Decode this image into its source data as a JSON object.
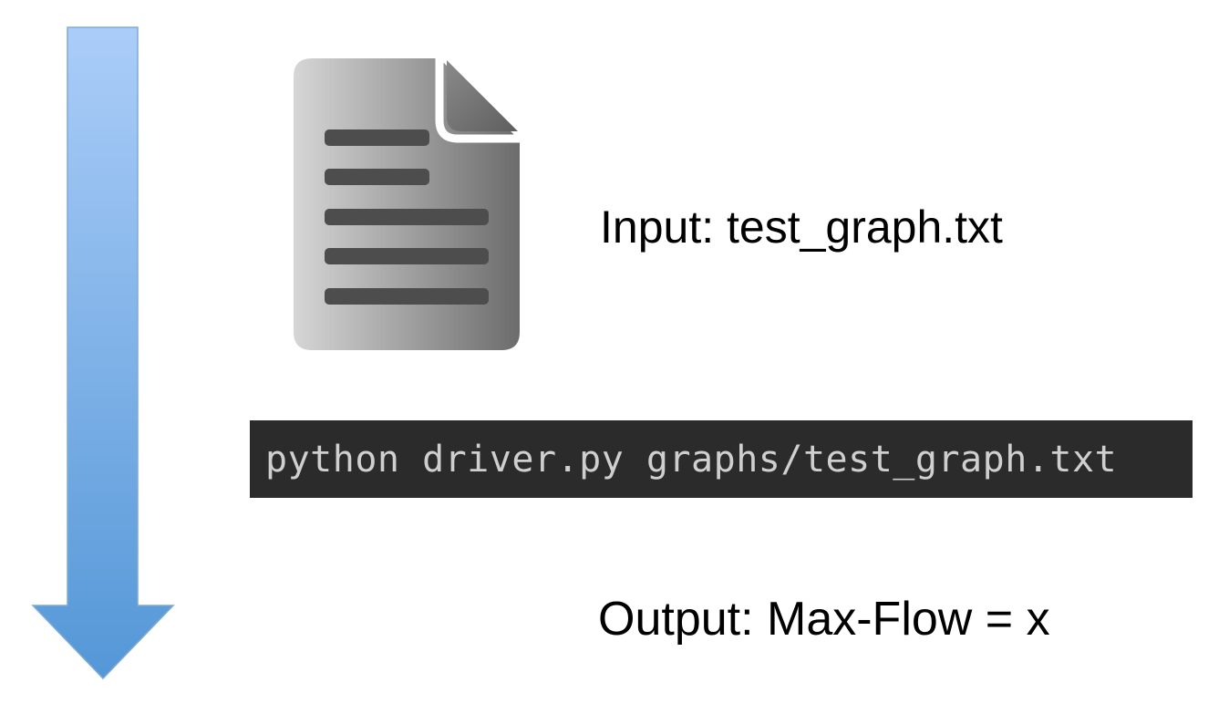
{
  "diagram": {
    "input_label": "Input: test_graph.txt",
    "command": "python driver.py graphs/test_graph.txt",
    "output_label": "Output: Max-Flow = x"
  },
  "icons": {
    "flow_arrow": "arrow-down-icon",
    "file": "document-icon"
  },
  "colors": {
    "arrow_top": "#a9ccf7",
    "arrow_bottom": "#5799d8",
    "terminal_bg": "#2b2b2b",
    "terminal_text": "#cfcfcf"
  }
}
